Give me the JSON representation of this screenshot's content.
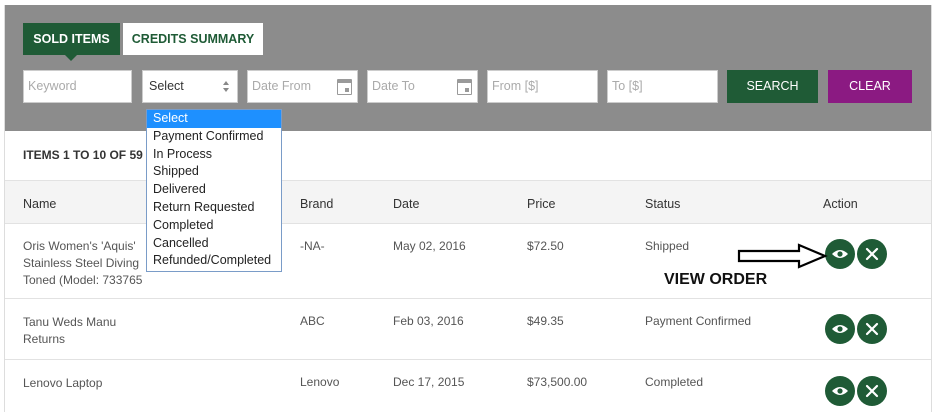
{
  "tabs": [
    {
      "label": "SOLD ITEMS",
      "active": true
    },
    {
      "label": "CREDITS SUMMARY",
      "active": false
    }
  ],
  "filters": {
    "keyword_placeholder": "Keyword",
    "status_select_value": "Select",
    "date_from_placeholder": "Date From",
    "date_to_placeholder": "Date To",
    "price_from_placeholder": "From [$]",
    "price_to_placeholder": "To [$]",
    "search_label": "SEARCH",
    "clear_label": "CLEAR"
  },
  "status_dropdown": {
    "options": [
      "Select",
      "Payment Confirmed",
      "In Process",
      "Shipped",
      "Delivered",
      "Return Requested",
      "Completed",
      "Cancelled",
      "Refunded/Completed"
    ],
    "highlighted": "Select"
  },
  "items_count": "ITEMS 1 TO 10 OF 59",
  "table": {
    "headers": {
      "name": "Name",
      "brand": "Brand",
      "date": "Date",
      "price": "Price",
      "status": "Status",
      "action": "Action"
    },
    "rows": [
      {
        "name_lines": [
          "Oris Women's 'Aquis'",
          "Stainless Steel Diving",
          "Toned (Model: 733765"
        ],
        "brand": "-NA-",
        "date": "May 02, 2016",
        "price": "$72.50",
        "status": "Shipped"
      },
      {
        "name_lines": [
          "Tanu Weds Manu Returns"
        ],
        "brand": "ABC",
        "date": "Feb 03, 2016",
        "price": "$49.35",
        "status": "Payment Confirmed"
      },
      {
        "name_lines": [
          "Lenovo Laptop"
        ],
        "brand": "Lenovo",
        "date": "Dec 17, 2015",
        "price": "$73,500.00",
        "status": "Completed"
      }
    ]
  },
  "annotation": {
    "label": "VIEW ORDER",
    "icon": "arrow-right-icon"
  },
  "colors": {
    "panel": "#8c8c8c",
    "primary_green": "#1f5b36",
    "clear_purple": "#8b1a82",
    "dropdown_highlight": "#1e90ff"
  },
  "icons": {
    "view": "eye-icon",
    "remove": "close-icon",
    "calendar": "calendar-icon",
    "select_arrows": "select-arrows-icon"
  }
}
